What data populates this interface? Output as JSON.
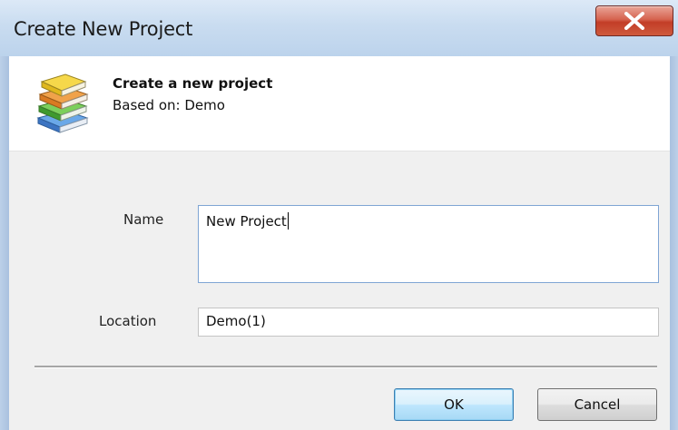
{
  "window": {
    "title": "Create New Project",
    "close_symbol": "X"
  },
  "header": {
    "icon": "books-icon",
    "title": "Create a new project",
    "subtitle": "Based on: Demo"
  },
  "form": {
    "name_label": "Name",
    "name_value": "New Project",
    "location_label": "Location",
    "location_value": "Demo(1)"
  },
  "buttons": {
    "ok": "OK",
    "cancel": "Cancel"
  },
  "colors": {
    "titlebar": "#c9dcf0",
    "close_button": "#c23d27",
    "dialog_body": "#f0f0f0",
    "input_focus_border": "#7fa5d4"
  }
}
